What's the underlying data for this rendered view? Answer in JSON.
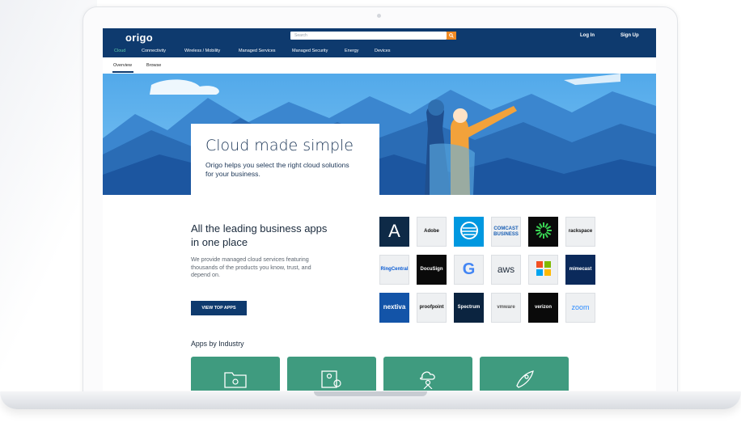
{
  "topbar": {
    "logo": "origo",
    "search_placeholder": "Search",
    "login": "Log In",
    "signup": "Sign Up"
  },
  "nav": {
    "items": [
      "Cloud",
      "Connectivity",
      "Wireless / Mobility",
      "Managed Services",
      "Managed Security",
      "Energy",
      "Devices"
    ]
  },
  "subnav": {
    "items": [
      "Overview",
      "Browse"
    ]
  },
  "hero": {
    "title": "Cloud made simple",
    "subtitle": "Origo helps you select the right cloud solutions for your business."
  },
  "leading": {
    "title": "All the leading business apps in one place",
    "description": "We provide managed cloud services featuring thousands of the products you know, trust, and depend on.",
    "button": "VIEW TOP APPS"
  },
  "apps": [
    {
      "label": "A",
      "icon": "azure-icon",
      "bg": "#0e2a47",
      "fg": "#ffffff"
    },
    {
      "label": "Adobe",
      "icon": "adobe-icon",
      "bg": "#eef0f2",
      "fg": "#111111"
    },
    {
      "label": "",
      "icon": "att-icon",
      "bg": "#0098e0",
      "fg": "#ffffff"
    },
    {
      "label": "COMCAST BUSINESS",
      "icon": "comcast-icon",
      "bg": "#eef0f2",
      "fg": "#1a5fb4"
    },
    {
      "label": "",
      "icon": "nutanix-icon",
      "bg": "#0a0a0a",
      "fg": "#39d353"
    },
    {
      "label": "rackspace",
      "icon": "rackspace-icon",
      "bg": "#eef0f2",
      "fg": "#111111"
    },
    {
      "label": "RingCentral",
      "icon": "ringcentral-icon",
      "bg": "#eef0f2",
      "fg": "#0a5bd3"
    },
    {
      "label": "DocuSign",
      "icon": "docusign-icon",
      "bg": "#0a0a0a",
      "fg": "#ffffff"
    },
    {
      "label": "G",
      "icon": "google-icon",
      "bg": "#eef0f2",
      "fg": "#4285f4"
    },
    {
      "label": "aws",
      "icon": "aws-icon",
      "bg": "#eef0f2",
      "fg": "#232f3e"
    },
    {
      "label": "",
      "icon": "microsoft-icon",
      "bg": "#eef0f2",
      "fg": "#111111"
    },
    {
      "label": "mimecast",
      "icon": "mimecast-icon",
      "bg": "#0b2a5b",
      "fg": "#ffffff"
    },
    {
      "label": "nextiva",
      "icon": "nextiva-icon",
      "bg": "#1354a8",
      "fg": "#ffffff"
    },
    {
      "label": "proofpoint",
      "icon": "proofpoint-icon",
      "bg": "#eef0f2",
      "fg": "#111111"
    },
    {
      "label": "Spectrum",
      "icon": "spectrum-icon",
      "bg": "#0b2440",
      "fg": "#ffffff"
    },
    {
      "label": "vmware",
      "icon": "vmware-icon",
      "bg": "#eef0f2",
      "fg": "#555555"
    },
    {
      "label": "verizon",
      "icon": "verizon-icon",
      "bg": "#0a0a0a",
      "fg": "#ffffff"
    },
    {
      "label": "zoom",
      "icon": "zoom-icon",
      "bg": "#eef0f2",
      "fg": "#2d8cff"
    }
  ],
  "industry": {
    "title": "Apps by Industry"
  }
}
